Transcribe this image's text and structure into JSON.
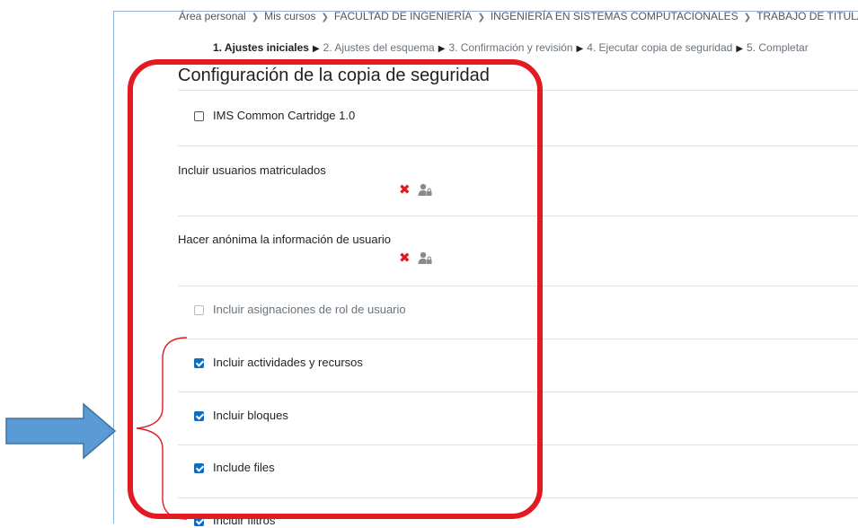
{
  "breadcrumb": [
    "Área personal",
    "Mis cursos",
    "FACULTAD DE INGENIERÍA",
    "INGENIERÍA EN SISTEMAS COMPUTACIONALES",
    "TRABAJO DE TITULACIÓN-PA"
  ],
  "steps": {
    "current": "1. Ajustes iniciales",
    "others": [
      "2. Ajustes del esquema",
      "3. Confirmación y revisión",
      "4. Ejecutar copia de seguridad",
      "5. Completar"
    ]
  },
  "section_title": "Configuración de la copia de seguridad",
  "settings": {
    "ims": {
      "label": "IMS Common Cartridge 1.0",
      "checked": false
    },
    "users": {
      "label": "Incluir usuarios matriculados"
    },
    "anonymize": {
      "label": "Hacer anónima la información de usuario"
    },
    "role_assignments": {
      "label": "Incluir asignaciones de rol de usuario",
      "checked": false,
      "disabled": true
    },
    "activities": {
      "label": "Incluir actividades y recursos",
      "checked": true
    },
    "blocks": {
      "label": "Incluir bloques",
      "checked": true
    },
    "files": {
      "label": "Include files",
      "checked": true
    },
    "filters": {
      "label": "Incluir filtros",
      "checked": true
    }
  },
  "icons": {
    "not_allowed": "close-icon",
    "locked": "user-lock-icon",
    "separator": "chevron-right-icon"
  },
  "colors": {
    "highlight_box": "#e21b23",
    "arrow": "#5b9bd5",
    "checkbox": "#0f6cbf",
    "cross": "#e0191e"
  }
}
